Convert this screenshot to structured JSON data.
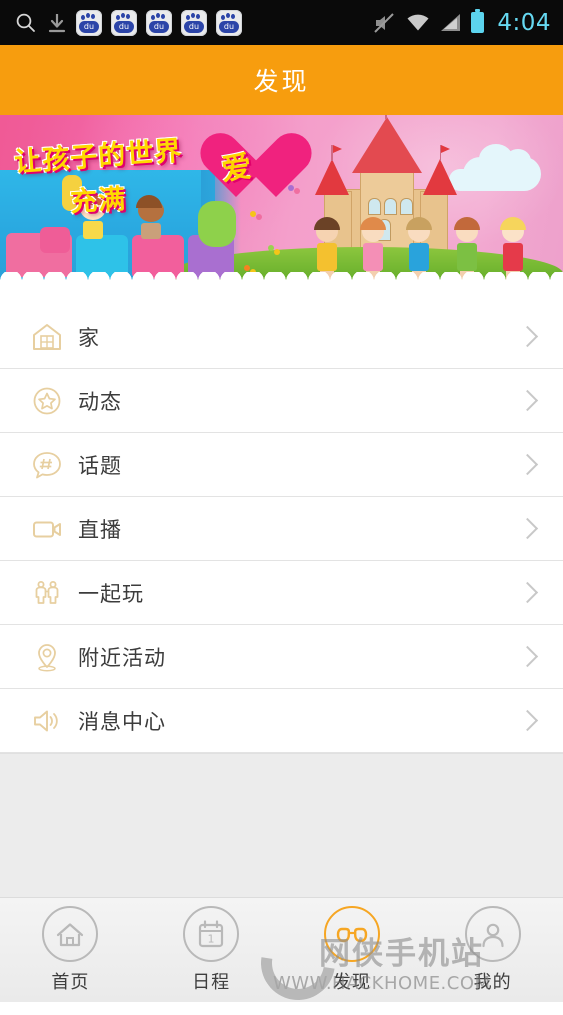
{
  "statusbar": {
    "time": "4:04",
    "left_icons": [
      "search-icon",
      "download-icon",
      "baidu-app-icon",
      "baidu-app-icon",
      "baidu-app-icon",
      "baidu-app-icon",
      "baidu-app-icon"
    ],
    "right_icons": [
      "mute-icon",
      "wifi-icon",
      "signal-icon",
      "battery-icon"
    ],
    "baidu_label": "du"
  },
  "header": {
    "title": "发现",
    "bg_color": "#f79d0e",
    "text_color": "#ffffff"
  },
  "banner": {
    "headline_line1": "让孩子的世界",
    "headline_line2": "充满",
    "heart_text": "爱",
    "alt": "儿童乐园横幅：城堡、小朋友、小火车、玩具"
  },
  "list": {
    "items": [
      {
        "icon": "house-icon",
        "label": "家"
      },
      {
        "icon": "star-circle-icon",
        "label": "动态"
      },
      {
        "icon": "hashtag-bubble-icon",
        "label": "话题"
      },
      {
        "icon": "video-camera-icon",
        "label": "直播"
      },
      {
        "icon": "two-people-icon",
        "label": "一起玩"
      },
      {
        "icon": "location-pin-icon",
        "label": "附近活动"
      },
      {
        "icon": "speaker-icon",
        "label": "消息中心"
      }
    ],
    "chevron": "chevron-right-icon",
    "icon_color": "#e7cfa0"
  },
  "tabbar": {
    "items": [
      {
        "icon": "home-icon",
        "label": "首页",
        "active": false
      },
      {
        "icon": "calendar-icon",
        "label": "日程",
        "active": false
      },
      {
        "icon": "binoculars-icon",
        "label": "发现",
        "active": true
      },
      {
        "icon": "person-icon",
        "label": "我的",
        "active": false
      }
    ],
    "calendar_day": "1",
    "active_color": "#f6a623",
    "inactive_color": "#b9b9b9"
  },
  "watermark": {
    "brand": "网侠手机站",
    "url": "WWW.HACKHOME.COM"
  }
}
